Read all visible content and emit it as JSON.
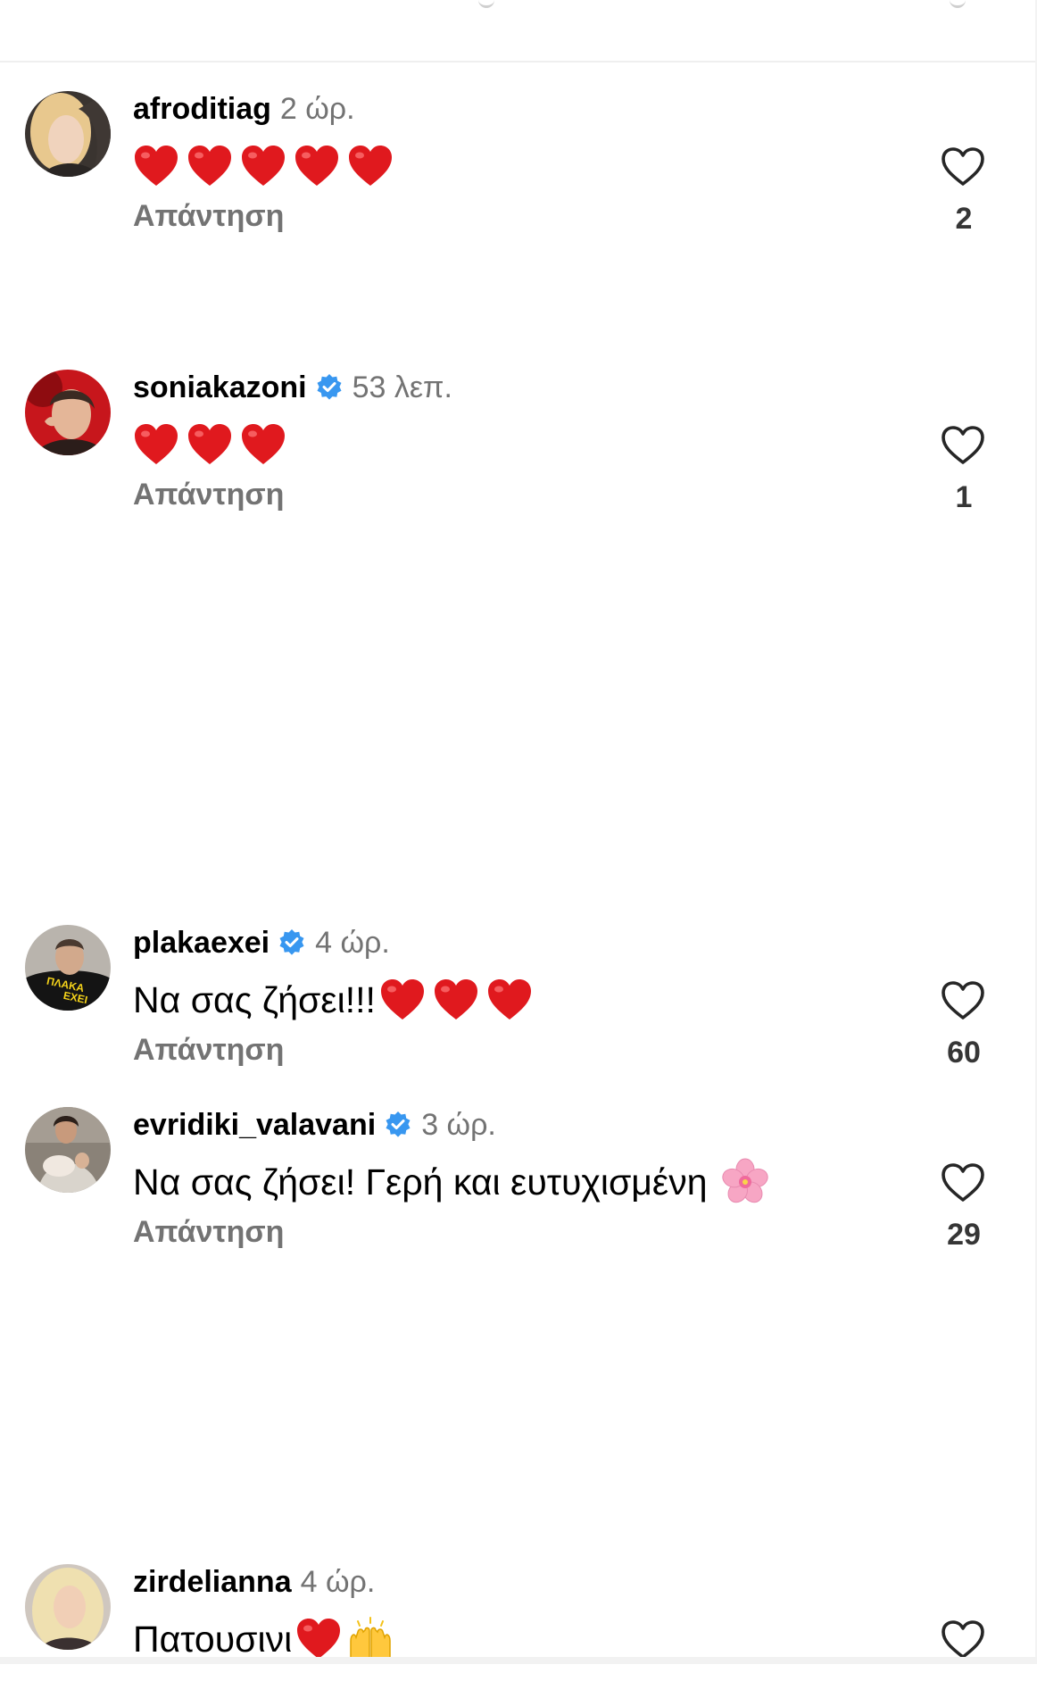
{
  "comments": [
    {
      "username": "afroditiag",
      "time": "2 ώρ.",
      "text": "",
      "reply_label": "Απάντηση",
      "like_count": "2"
    },
    {
      "username": "soniakazoni",
      "time": "53 λεπ.",
      "text": "",
      "reply_label": "Απάντηση",
      "like_count": "1"
    },
    {
      "username": "plakaexei",
      "time": "4 ώρ.",
      "text": "Να σας ζήσει!!!",
      "reply_label": "Απάντηση",
      "like_count": "60",
      "avatar_text": "ΠΛΑΚΑ ΕΧΕΙ"
    },
    {
      "username": "evridiki_valavani",
      "time": "3 ώρ.",
      "text": "Να σας ζήσει! Γερή και ευτυχισμένη",
      "reply_label": "Απάντηση",
      "like_count": "29"
    },
    {
      "username": "zirdelianna",
      "time": "4 ώρ.",
      "text": "Πατουσινι"
    }
  ],
  "icons": {
    "like": "heart-outline-icon",
    "verified": "verified-badge-icon",
    "emoji_heart": "red-heart-emoji",
    "emoji_flower": "cherry-blossom-emoji",
    "emoji_hands": "raising-hands-emoji"
  },
  "colors": {
    "background": "#ffffff",
    "username": "#000000",
    "secondary_text": "#737373",
    "verified_blue": "#3897f0",
    "heart_red": "#e0191e",
    "divider": "#efefef"
  }
}
